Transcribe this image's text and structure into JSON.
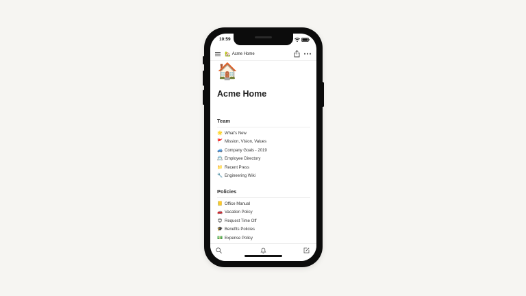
{
  "status_bar": {
    "time": "10:59",
    "icons": [
      "cellular-signal-icon",
      "wifi-icon",
      "battery-icon"
    ]
  },
  "topbar": {
    "menu_icon": "hamburger-menu-icon",
    "breadcrumb": {
      "emoji": "🏡",
      "label": "Acme Home"
    },
    "actions": [
      "share-icon",
      "more-options-icon"
    ]
  },
  "page": {
    "icon": "🏠",
    "title": "Acme Home"
  },
  "sections": {
    "team": {
      "heading": "Team",
      "items": [
        {
          "emoji": "🌟",
          "label": "What's New"
        },
        {
          "emoji": "🚩",
          "label": "Mission, Vision, Values"
        },
        {
          "emoji": "🚙",
          "label": "Company Goals - 2019"
        },
        {
          "emoji": "📇",
          "label": "Employee Directory"
        },
        {
          "emoji": "📁",
          "label": "Recent Press"
        },
        {
          "emoji": "🔧",
          "label": "Engineering Wiki"
        }
      ]
    },
    "policies": {
      "heading": "Policies",
      "items": [
        {
          "emoji": "📒",
          "label": "Office Manual"
        },
        {
          "emoji": "🚗",
          "label": "Vacation Policy"
        },
        {
          "emoji": "😊",
          "label": "Request Time Off"
        },
        {
          "emoji": "🎓",
          "label": "Benefits Policies"
        },
        {
          "emoji": "💵",
          "label": "Expense Policy"
        }
      ]
    }
  },
  "tabbar": {
    "tabs": [
      "search-icon",
      "notifications-bell-icon",
      "new-page-compose-icon"
    ]
  },
  "colors": {
    "background": "#f6f5f2",
    "phone_frame": "#0c0c0c",
    "screen": "#ffffff",
    "text_primary": "#222222",
    "divider": "#ececec"
  }
}
